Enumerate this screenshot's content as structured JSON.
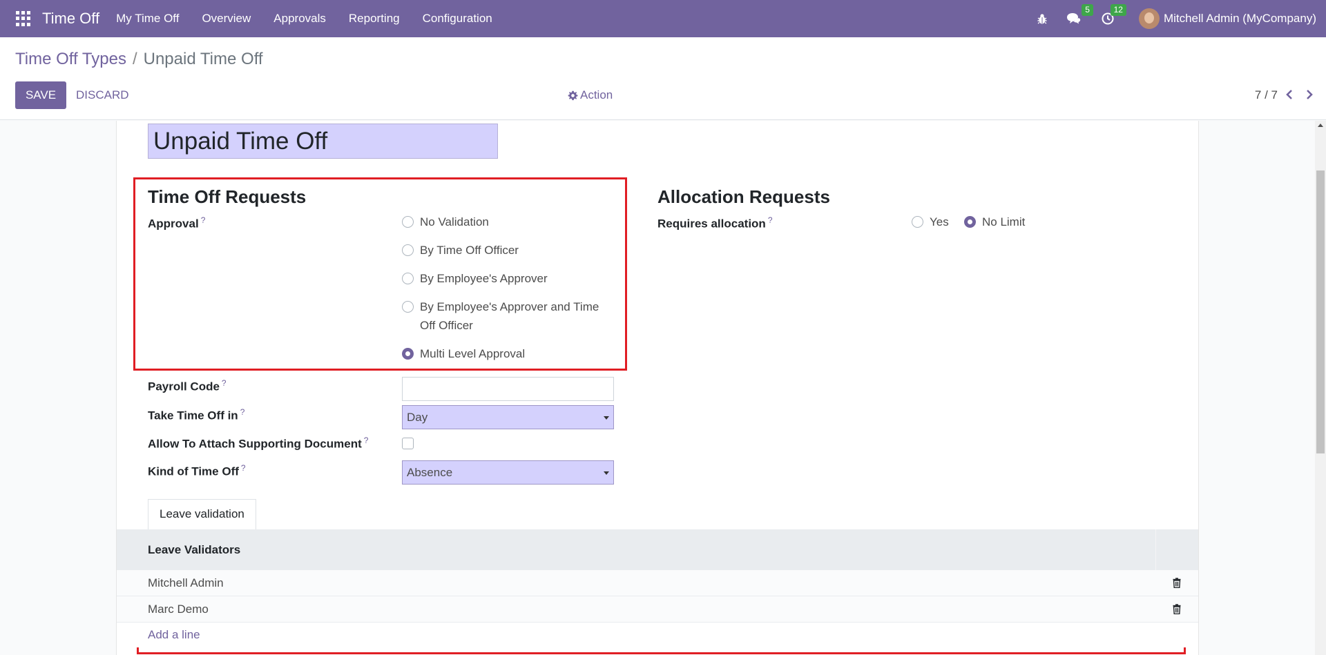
{
  "navbar": {
    "app_name": "Time Off",
    "menu": [
      "My Time Off",
      "Overview",
      "Approvals",
      "Reporting",
      "Configuration"
    ],
    "messages_count": "5",
    "activities_count": "12",
    "user": "Mitchell Admin (MyCompany)"
  },
  "breadcrumb": {
    "parent": "Time Off Types",
    "separator": "/",
    "current": "Unpaid Time Off"
  },
  "toolbar": {
    "save_label": "SAVE",
    "discard_label": "DISCARD",
    "action_label": "Action",
    "pager": "7 / 7"
  },
  "form": {
    "name": "Unpaid Time Off",
    "time_off_requests": {
      "title": "Time Off Requests",
      "approval_label": "Approval",
      "help": "?",
      "options": [
        {
          "label": "No Validation",
          "checked": false
        },
        {
          "label": "By Time Off Officer",
          "checked": false
        },
        {
          "label": "By Employee's Approver",
          "checked": false
        },
        {
          "label": "By Employee's Approver and Time Off Officer",
          "checked": false
        },
        {
          "label": "Multi Level Approval",
          "checked": true
        }
      ]
    },
    "allocation_requests": {
      "title": "Allocation Requests",
      "requires_label": "Requires allocation",
      "help": "?",
      "options": [
        {
          "label": "Yes",
          "checked": false
        },
        {
          "label": "No Limit",
          "checked": true
        }
      ]
    },
    "payroll_code": {
      "label": "Payroll Code",
      "help": "?",
      "value": ""
    },
    "take_time_off_in": {
      "label": "Take Time Off in",
      "help": "?",
      "value": "Day"
    },
    "attach_doc": {
      "label": "Allow To Attach Supporting Document",
      "help": "?",
      "checked": false
    },
    "kind": {
      "label": "Kind of Time Off",
      "help": "?",
      "value": "Absence"
    }
  },
  "tabs": [
    "Leave validation"
  ],
  "validators": {
    "header": "Leave Validators",
    "rows": [
      "Mitchell Admin",
      "Marc Demo"
    ],
    "add_line": "Add a line"
  },
  "colors": {
    "brand": "#71639e",
    "highlight": "#e01e24",
    "badge": "#3ea64a",
    "field_bg": "#d4d1fd"
  }
}
